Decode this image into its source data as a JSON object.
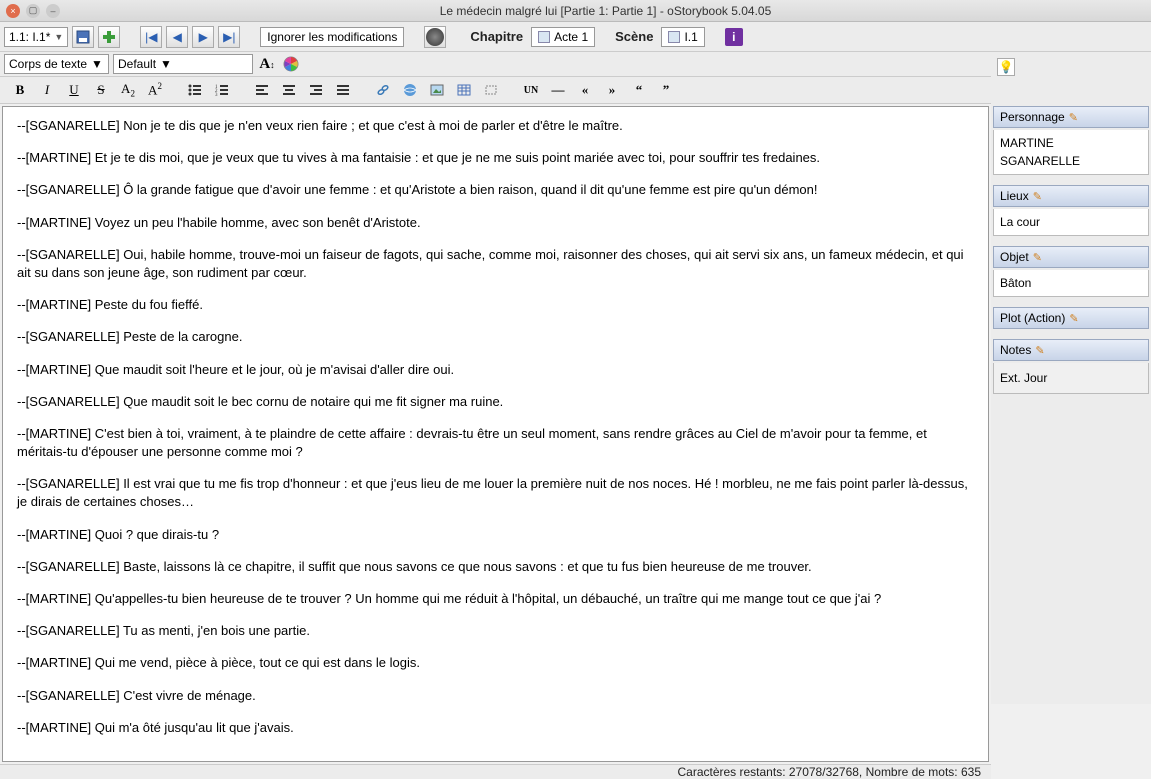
{
  "window": {
    "title": "Le médecin malgré lui [Partie 1: Partie 1] - oStorybook 5.04.05"
  },
  "toolbar1": {
    "location": "1.1: I.1*",
    "ignore_mods": "Ignorer les modifications",
    "chapter_label": "Chapitre",
    "chapter_value": "Acte 1",
    "scene_label": "Scène",
    "scene_value": "I.1"
  },
  "toolbar2": {
    "para_style": "Corps de texte",
    "font_family": "Default"
  },
  "format": {
    "bold": "B",
    "italic": "I",
    "underline": "U",
    "strike": "S",
    "subscript": "A",
    "superscript": "A",
    "uni": "UN",
    "dash": "—",
    "laquo": "«",
    "raquo": "»",
    "ldquo": "“",
    "rdquo": "”"
  },
  "content": {
    "paragraphs": [
      "--[SGANARELLE] Non je te dis que je n'en veux rien faire ; et que c'est à moi de parler et d'être le maître.",
      "--[MARTINE] Et je te dis moi, que je veux que tu vives à ma fantaisie : et que je ne me suis point mariée avec toi, pour souffrir tes fredaines.",
      "--[SGANARELLE] Ô la grande fatigue que d'avoir une femme : et qu'Aristote a bien raison, quand il dit qu'une femme est pire qu'un démon!",
      "--[MARTINE] Voyez un peu l'habile homme, avec son benêt d'Aristote.",
      "--[SGANARELLE] Oui, habile homme, trouve-moi un faiseur de fagots, qui sache, comme moi, raisonner des choses, qui ait servi six ans, un fameux médecin, et qui ait su dans son jeune âge, son rudiment par cœur.",
      "--[MARTINE] Peste du fou fieffé.",
      "--[SGANARELLE] Peste de la carogne.",
      "--[MARTINE] Que maudit soit l'heure et le jour, où je m'avisai d'aller dire oui.",
      "--[SGANARELLE] Que maudit soit le bec cornu de notaire qui me fit signer ma ruine.",
      "--[MARTINE] C'est bien à toi, vraiment, à te plaindre de cette affaire : devrais-tu être un seul moment, sans rendre grâces au Ciel de m'avoir pour ta femme, et méritais-tu d'épouser une personne comme moi ?",
      "--[SGANARELLE] Il est vrai que tu me fis trop d'honneur : et que j'eus lieu de me louer la première nuit de nos noces. Hé ! morbleu, ne me fais point parler là-dessus, je dirais de certaines choses…",
      "--[MARTINE] Quoi ? que dirais-tu ?",
      "--[SGANARELLE] Baste, laissons là ce chapitre, il suffit que nous savons ce que nous savons : et que tu fus bien heureuse de me trouver.",
      "--[MARTINE] Qu'appelles-tu bien heureuse de te trouver ? Un homme qui me réduit à l'hôpital, un débauché, un traître qui me mange tout ce que j'ai ?",
      "--[SGANARELLE] Tu as menti, j'en bois une partie.",
      "--[MARTINE] Qui me vend, pièce à pièce, tout ce qui est dans le logis.",
      "--[SGANARELLE] C'est vivre de ménage.",
      "--[MARTINE] Qui m'a ôté jusqu'au lit que j'avais."
    ]
  },
  "sidebar": {
    "personnage": {
      "title": "Personnage",
      "items": [
        "MARTINE",
        "SGANARELLE"
      ]
    },
    "lieux": {
      "title": "Lieux",
      "items": [
        "La cour"
      ]
    },
    "objet": {
      "title": "Objet",
      "items": [
        "Bâton"
      ]
    },
    "plot": {
      "title": "Plot (Action)"
    },
    "notes": {
      "title": "Notes",
      "value": "Ext. Jour"
    }
  },
  "status": {
    "text": "Caractères restants: 27078/32768, Nombre de mots: 635"
  }
}
